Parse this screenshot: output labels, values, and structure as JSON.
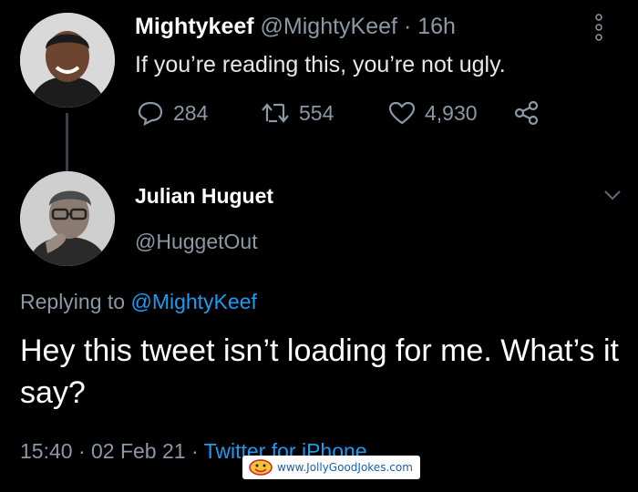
{
  "tweet1": {
    "name": "Mightykeef",
    "handle": "@MightyKeef",
    "separator": "·",
    "time": "16h",
    "text": "If you’re reading this, you’re not ugly.",
    "replies": "284",
    "retweets": "554",
    "likes": "4,930",
    "icons": [
      "reply-icon",
      "retweet-icon",
      "like-icon",
      "share-icon",
      "more-icon"
    ]
  },
  "tweet2": {
    "name": "Julian Huguet",
    "handle": "@HuggetOut",
    "replying_prefix": "Replying to",
    "replying_handle": "@MightyKeef",
    "text": "Hey this tweet isn’t loading for me. What’s it say?",
    "timestamp": "15:40 · 02 Feb 21 ·",
    "source": "Twitter for iPhone"
  },
  "watermark": {
    "text": "www.JollyGoodJokes.com"
  },
  "colors": {
    "background": "#000000",
    "secondary_text": "#8b98a5",
    "link": "#1d9bf0"
  }
}
